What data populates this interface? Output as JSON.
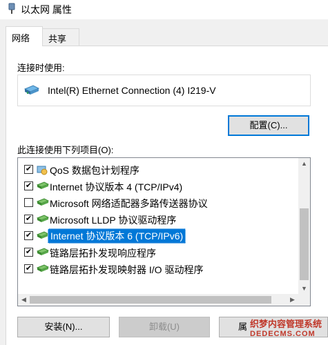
{
  "window": {
    "title": "以太网 属性"
  },
  "tabs": [
    {
      "label": "网络",
      "active": true
    },
    {
      "label": "共享",
      "active": false
    }
  ],
  "connect_using_label": "连接时使用:",
  "adapter_name": "Intel(R) Ethernet Connection (4) I219-V",
  "configure_button": "配置(C)...",
  "items_label": "此连接使用下列项目(O):",
  "items": [
    {
      "label": "QoS 数据包计划程序",
      "checked": true,
      "icon": "qos-icon"
    },
    {
      "label": "Internet 协议版本 4 (TCP/IPv4)",
      "checked": true,
      "icon": "protocol-icon"
    },
    {
      "label": "Microsoft 网络适配器多路传送器协议",
      "checked": false,
      "icon": "protocol-icon"
    },
    {
      "label": "Microsoft LLDP 协议驱动程序",
      "checked": true,
      "icon": "protocol-icon"
    },
    {
      "label": "Internet 协议版本 6 (TCP/IPv6)",
      "checked": true,
      "icon": "protocol-icon",
      "selected": true
    },
    {
      "label": "链路层拓扑发现响应程序",
      "checked": true,
      "icon": "protocol-icon"
    },
    {
      "label": "链路层拓扑发现映射器 I/O 驱动程序",
      "checked": true,
      "icon": "protocol-icon"
    }
  ],
  "buttons": {
    "install": "安装(N)...",
    "uninstall": "卸载(U)",
    "properties": "属"
  },
  "watermark": {
    "text_cn": "织梦内容管理系统",
    "text_en": "DEDECMS.COM"
  },
  "colors": {
    "accent": "#0078d7",
    "panel": "#f0f0f0"
  }
}
